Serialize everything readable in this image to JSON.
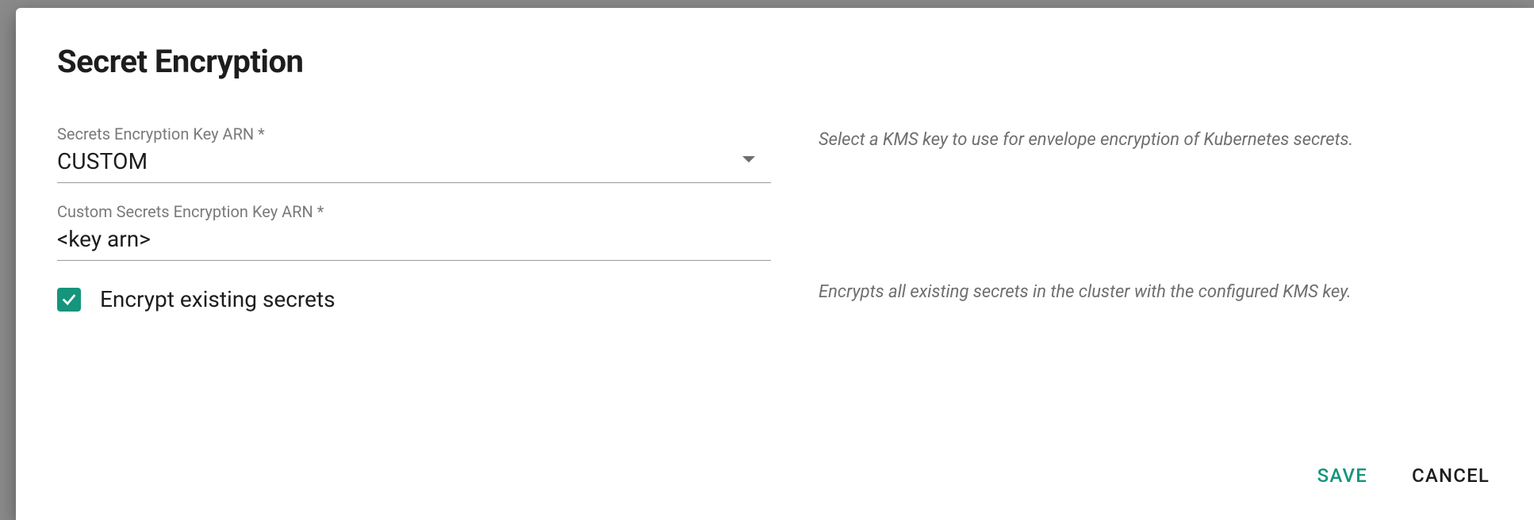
{
  "dialog": {
    "title": "Secret Encryption",
    "fields": {
      "arn_select": {
        "label": "Secrets Encryption Key ARN *",
        "value": "CUSTOM",
        "help": "Select a KMS key to use for envelope encryption of Kubernetes secrets."
      },
      "custom_arn": {
        "label": "Custom Secrets Encryption Key ARN *",
        "value": "<key arn>"
      },
      "encrypt_existing": {
        "label": "Encrypt existing secrets",
        "checked": true,
        "help": "Encrypts all existing secrets in the cluster with the configured KMS key."
      }
    },
    "actions": {
      "save": "SAVE",
      "cancel": "CANCEL"
    }
  }
}
